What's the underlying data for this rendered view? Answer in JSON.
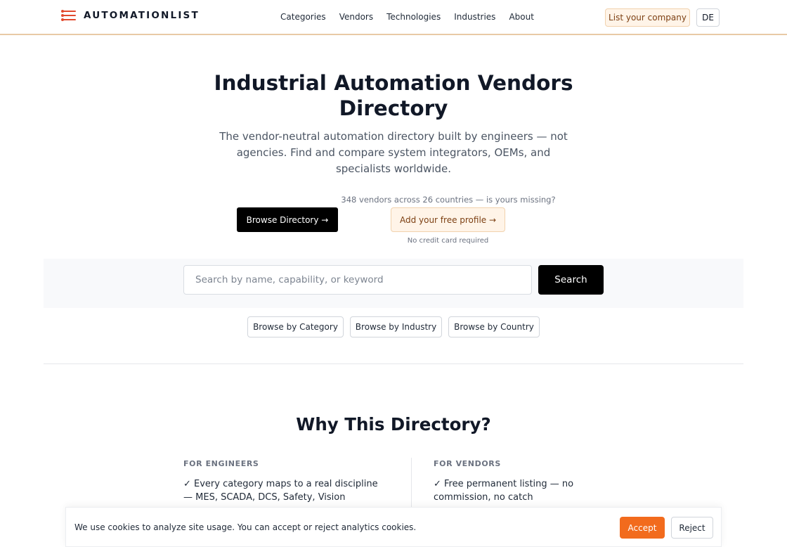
{
  "header": {
    "logo_icon": "list-menu-icon",
    "brand": "AUTOMATIONLIST",
    "nav": [
      "Categories",
      "Vendors",
      "Technologies",
      "Industries",
      "About"
    ],
    "list_company": "List your company",
    "language": "DE"
  },
  "hero": {
    "title": "Industrial Automation Vendors Directory",
    "subtitle": "The vendor-neutral automation directory built by engineers — not agencies. Find and compare system integrators, OEMs, and specialists worldwide.",
    "browse_button": "Browse Directory →",
    "vendor_count": "348 vendors across 26 countries — is yours missing?",
    "add_profile_button": "Add your free profile →",
    "no_credit_card": "No credit card required"
  },
  "search": {
    "placeholder": "Search by name, capability, or keyword",
    "value": "",
    "button": "Search"
  },
  "browse": {
    "category": "Browse by Category",
    "industry": "Browse by Industry",
    "country": "Browse by Country"
  },
  "why": {
    "title": "Why This Directory?",
    "engineers": {
      "label": "FOR ENGINEERS",
      "point": "✓ Every category maps to a real discipline — MES, SCADA, DCS, Safety, Vision"
    },
    "vendors": {
      "label": "FOR VENDORS",
      "point": "✓ Free permanent listing — no commission, no catch"
    }
  },
  "cookie": {
    "text": "We use cookies to analyze site usage. You can accept or reject analytics cookies.",
    "accept": "Accept",
    "reject": "Reject"
  },
  "colors": {
    "accent": "#f26b1d",
    "logo": "#e2492e",
    "primary_button": "#000000",
    "soft_orange": "#fff4e8"
  }
}
